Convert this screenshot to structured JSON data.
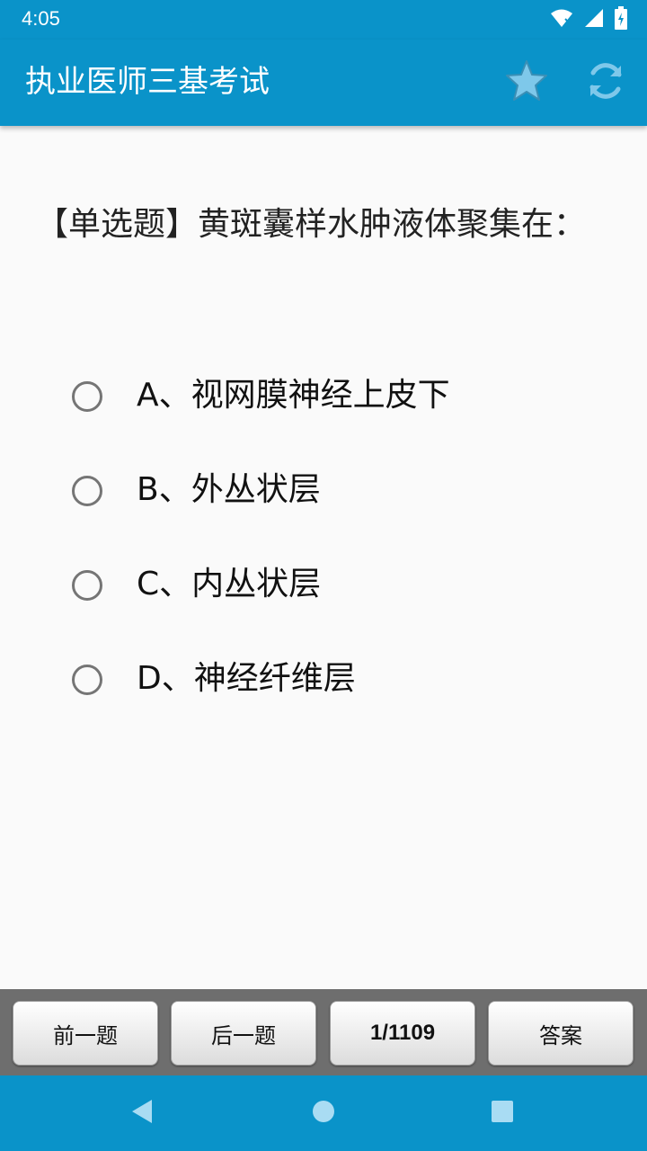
{
  "status_bar": {
    "time": "4:05",
    "icons": [
      "wifi-icon",
      "signal-icon",
      "battery-icon"
    ]
  },
  "app_bar": {
    "title": "执业医师三基考试",
    "actions": [
      "star-icon",
      "refresh-icon"
    ]
  },
  "question": {
    "text": "【单选题】黄斑囊样水肿液体聚集在："
  },
  "options": [
    {
      "label": "A、视网膜神经上皮下",
      "selected": false
    },
    {
      "label": "B、外丛状层",
      "selected": false
    },
    {
      "label": "C、内丛状层",
      "selected": false
    },
    {
      "label": "D、神经纤维层",
      "selected": false
    }
  ],
  "bottom_bar": {
    "prev_label": "前一题",
    "next_label": "后一题",
    "counter": "1/1109",
    "answer_label": "答案"
  },
  "nav_bar": {
    "icons": [
      "back-icon",
      "home-icon",
      "recents-icon"
    ]
  },
  "colors": {
    "primary": "#0a93c9",
    "star": "#7ec8ea",
    "panel": "#6e6e6e"
  }
}
